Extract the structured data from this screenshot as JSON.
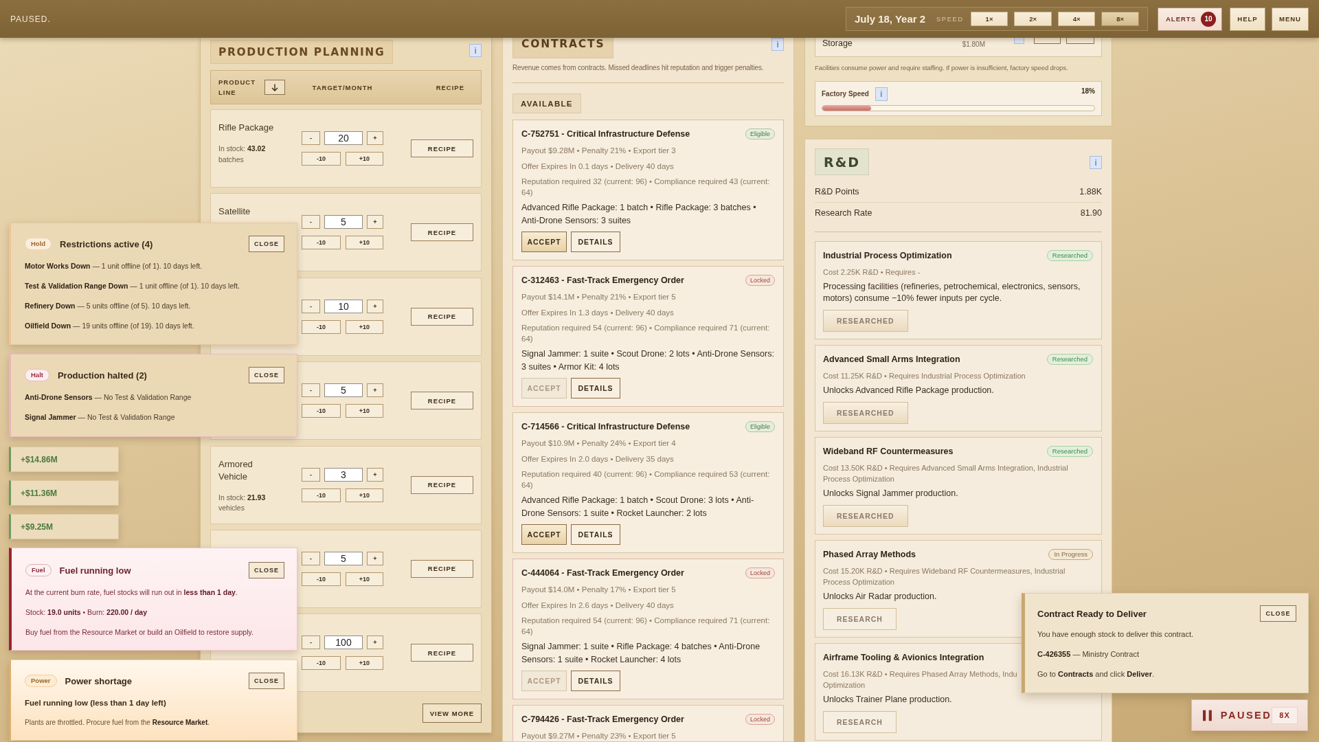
{
  "top_bar": {
    "status": "PAUSED.",
    "date": "July 18, Year 2",
    "speed_label": "SPEED",
    "speeds": [
      {
        "label": "1×",
        "selected": false
      },
      {
        "label": "2×",
        "selected": false
      },
      {
        "label": "4×",
        "selected": false
      },
      {
        "label": "8×",
        "selected": true
      }
    ],
    "alerts": {
      "label": "ALERTS",
      "count": "10"
    },
    "help": "HELP",
    "menu": "MENU"
  },
  "production_planning": {
    "title": "PRODUCTION PLANNING",
    "info": "i",
    "columns": {
      "product_line": "PRODUCT LINE",
      "target": "TARGET/MONTH",
      "recipe": "RECIPE"
    },
    "rows": [
      {
        "name": "Rifle Package",
        "stock": "In stock: **43.02** batches",
        "target": "20",
        "dec": "-",
        "inc": "+",
        "minus_ten": "-10",
        "plus_ten": "+10",
        "recipe": "RECIPE"
      },
      {
        "name": "Satellite",
        "target": "5",
        "dec": "-",
        "inc": "+",
        "minus_ten": "-10",
        "plus_ten": "+10",
        "recipe": "RECIPE"
      },
      {
        "target": "10",
        "dec": "-",
        "inc": "+",
        "minus_ten": "-10",
        "plus_ten": "+10",
        "recipe": "RECIPE"
      },
      {
        "target": "5",
        "dec": "-",
        "inc": "+",
        "minus_ten": "-10",
        "plus_ten": "+10",
        "recipe": "RECIPE"
      },
      {
        "name": "Armored Vehicle",
        "stock": "In stock: **21.93** vehicles",
        "target": "3",
        "dec": "-",
        "inc": "+",
        "minus_ten": "-10",
        "plus_ten": "+10",
        "recipe": "RECIPE"
      },
      {
        "target": "5",
        "dec": "-",
        "inc": "+",
        "minus_ten": "-10",
        "plus_ten": "+10",
        "recipe": "RECIPE"
      },
      {
        "target": "100",
        "dec": "-",
        "inc": "+",
        "minus_ten": "-10",
        "plus_ten": "+10",
        "recipe": "RECIPE"
      }
    ],
    "view_more": "VIEW MORE"
  },
  "contracts": {
    "title": "CONTRACTS",
    "info": "i",
    "subtitle": "Revenue comes from contracts. Missed deadlines hit reputation and trigger penalties.",
    "section": "AVAILABLE",
    "items": [
      {
        "kind": "eligible",
        "title": "C-752751 - Critical Infrastructure Defense",
        "badge": "Eligible",
        "terms": "Payout $9.28M • Penalty 21% • Export tier 3",
        "timing": "Offer Expires In 0.1 days • Delivery 40 days",
        "requirements": "Reputation required 32 (current: 96) • Compliance required 43 (current: 64)",
        "goods": "Advanced Rifle Package: 1 batch • Rifle Package: 3 batches • Anti-Drone Sensors: 3 suites",
        "accept": {
          "label": "ACCEPT",
          "disabled": false
        },
        "details": "DETAILS"
      },
      {
        "kind": "locked",
        "title": "C-312463 - Fast-Track Emergency Order",
        "badge": "Locked",
        "terms": "Payout $14.1M • Penalty 21% • Export tier 5",
        "timing": "Offer Expires In 1.3 days • Delivery 40 days",
        "requirements": "Reputation required 54 (current: 96) • Compliance required 71 (current: 64)",
        "goods": "Signal Jammer: 1 suite • Scout Drone: 2 lots • Anti-Drone Sensors: 3 suites • Armor Kit: 4 lots",
        "accept": {
          "label": "ACCEPT",
          "disabled": true
        },
        "details": "DETAILS"
      },
      {
        "kind": "eligible",
        "title": "C-714566 - Critical Infrastructure Defense",
        "badge": "Eligible",
        "terms": "Payout $10.9M • Penalty 24% • Export tier 4",
        "timing": "Offer Expires In 2.0 days • Delivery 35 days",
        "requirements": "Reputation required 40 (current: 96) • Compliance required 53 (current: 64)",
        "goods": "Advanced Rifle Package: 1 batch • Scout Drone: 3 lots • Anti-Drone Sensors: 1 suite • Rocket Launcher: 2 lots",
        "accept": {
          "label": "ACCEPT",
          "disabled": false
        },
        "details": "DETAILS"
      },
      {
        "kind": "locked",
        "title": "C-444064 - Fast-Track Emergency Order",
        "badge": "Locked",
        "terms": "Payout $14.0M • Penalty 17% • Export tier 5",
        "timing": "Offer Expires In 2.6 days • Delivery 40 days",
        "requirements": "Reputation required 54 (current: 96) • Compliance required 71 (current: 64)",
        "goods": "Signal Jammer: 1 suite • Rifle Package: 4 batches • Anti-Drone Sensors: 1 suite • Rocket Launcher: 4 lots",
        "accept": {
          "label": "ACCEPT",
          "disabled": true
        },
        "details": "DETAILS"
      },
      {
        "kind": "locked",
        "title": "C-794426 - Fast-Track Emergency Order",
        "badge": "Locked",
        "terms": "Payout $9.27M • Penalty 23% • Export tier 5"
      }
    ]
  },
  "facilities": {
    "row": {
      "name": "Storage",
      "cost": "$1.80M"
    },
    "note": "Facilities consume power and require staffing. If power is insufficient, factory speed drops.",
    "factory_speed": {
      "label": "Factory Speed",
      "info": "i",
      "reading": "18%",
      "level": 0.18
    }
  },
  "rnd": {
    "title": "R&D",
    "info": "i",
    "stats": [
      {
        "label": "R&D Points",
        "value": "1.88K"
      },
      {
        "label": "Research Rate",
        "value": "81.90"
      }
    ],
    "techs": [
      {
        "name": "Industrial Process Optimization",
        "badge": {
          "text": "Researched",
          "kind": "researched"
        },
        "cost": [
          "Cost 2.25K R&D • Requires -"
        ],
        "description": "Processing facilities (refineries, petrochemical, electronics, sensors, motors) consume −10% fewer inputs per cycle.",
        "researched": true,
        "button": {
          "label": "RESEARCHED",
          "disabled": true
        }
      },
      {
        "name": "Advanced Small Arms Integration",
        "badge": {
          "text": "Researched",
          "kind": "researched"
        },
        "cost": [
          "Cost 11.25K R&D • Requires Industrial Process Optimization"
        ],
        "description": "Unlocks Advanced Rifle Package production.",
        "researched": true,
        "button": {
          "label": "RESEARCHED",
          "disabled": true
        }
      },
      {
        "name": "Wideband RF Countermeasures",
        "badge": {
          "text": "Researched",
          "kind": "researched"
        },
        "cost": [
          "Cost 13.50K R&D • Requires Advanced Small Arms Integration, Industrial Process Optimization"
        ],
        "description": "Unlocks Signal Jammer production.",
        "researched": true,
        "button": {
          "label": "RESEARCHED",
          "disabled": true
        }
      },
      {
        "name": "Phased Array Methods",
        "badge": {
          "text": "In Progress",
          "kind": "in_progress"
        },
        "cost": [
          "Cost 15.20K R&D • Requires Wideband RF Countermeasures, Industrial Process Optimization"
        ],
        "description": "Unlocks Air Radar production.",
        "researched": false,
        "button": {
          "label": "RESEARCH",
          "disabled": true
        }
      },
      {
        "name": "Airframe Tooling & Avionics Integration",
        "cost": [
          "Cost 16.13K R&D • Requires Phased Array Methods, Indu",
          "Optimization"
        ],
        "description": "Unlocks Trainer Plane production.",
        "researched": false,
        "button": {
          "label": "RESEARCH",
          "disabled": true
        }
      }
    ]
  },
  "toasts": [
    {
      "kind": "restriction",
      "tag": "Hold",
      "title": "Restrictions active (4)",
      "close": "CLOSE",
      "lines": [
        "**Motor Works Down** — 1 unit offline (of 1). 10 days left.",
        "**Test & Validation Range Down** — 1 unit offline (of 1). 10 days left.",
        "**Refinery Down** — 5 units offline (of 5). 10 days left.",
        "**Oilfield Down** — 19 units offline (of 19). 10 days left."
      ]
    },
    {
      "kind": "halt",
      "tag": "Halt",
      "title": "Production halted (2)",
      "close": "CLOSE",
      "lines": [
        "**Anti-Drone Sensors** — No Test & Validation Range",
        "**Signal Jammer** — No Test & Validation Range"
      ]
    },
    {
      "kind": "revenue",
      "amount": "+$14.86M"
    },
    {
      "kind": "revenue",
      "amount": "+$11.36M"
    },
    {
      "kind": "revenue",
      "amount": "+$9.25M"
    },
    {
      "kind": "fuel",
      "tag": "Fuel",
      "title": "Fuel running low",
      "close": "CLOSE",
      "lines": [
        "At the current burn rate, fuel stocks will run out in **less than 1 day**.",
        "Stock: **19.0 units** • Burn: **220.00 / day**",
        "Buy fuel from the Resource Market or build an Oilfield to restore supply."
      ]
    },
    {
      "kind": "power",
      "tag": "Power",
      "title": "Power shortage",
      "close": "CLOSE",
      "lead": "Fuel running low (less than 1 day left)",
      "lines": [
        "Plants are throttled. Procure fuel from the **Resource Market**."
      ]
    }
  ],
  "delivery_notice": {
    "title": "Contract Ready to Deliver",
    "close": "CLOSE",
    "lines": [
      "You have enough stock to deliver this contract.",
      "**C-426355** — Ministry Contract",
      "Go to **Contracts** and click **Deliver**."
    ]
  },
  "pause_indicator": {
    "label": "PAUSED",
    "speed": "8X"
  }
}
